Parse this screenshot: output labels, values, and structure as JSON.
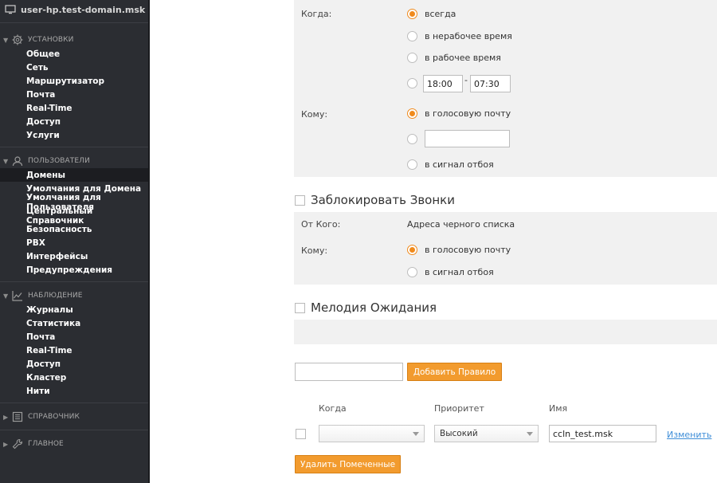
{
  "sidebar": {
    "host": "user-hp.test-domain.msk",
    "sections": [
      {
        "title": "Установки",
        "icon": "gear-icon",
        "items": [
          "Общее",
          "Сеть",
          "Маршрутизатор",
          "Почта",
          "Real-Time",
          "Доступ",
          "Услуги"
        ]
      },
      {
        "title": "Пользователи",
        "icon": "user-icon",
        "items": [
          "Домены",
          "Умолчания для Домена",
          "Умолчания для Пользователя",
          "Центральный Справочник",
          "Безопасность",
          "PBX",
          "Интерфейсы",
          "Предупреждения"
        ]
      },
      {
        "title": "Наблюдение",
        "icon": "chart-icon",
        "items": [
          "Журналы",
          "Статистика",
          "Почта",
          "Real-Time",
          "Доступ",
          "Кластер",
          "Нити"
        ]
      },
      {
        "title": "Справочник",
        "icon": "directory-icon",
        "items": []
      },
      {
        "title": "Главное",
        "icon": "wrench-icon",
        "items": []
      }
    ],
    "active_item": "Домены"
  },
  "forward": {
    "when_label": "Когда:",
    "when_options": [
      "всегда",
      "в нерабочее время",
      "в рабочее время"
    ],
    "time_from": "18:00",
    "time_sep": "-",
    "time_to": "07:30",
    "to_label": "Кому:",
    "to_options": [
      "в голосовую почту",
      "в сигнал отбоя"
    ],
    "to_custom_value": ""
  },
  "block": {
    "title": "Заблокировать Звонки",
    "from_label": "От Кого:",
    "from_value": "Адреса черного списка",
    "to_label": "Кому:",
    "to_options": [
      "в голосовую почту",
      "в сигнал отбоя"
    ]
  },
  "hold": {
    "title": "Мелодия Ожидания"
  },
  "rules": {
    "new_rule_value": "",
    "add_button": "Добавить Правило",
    "columns": [
      "Когда",
      "Приоритет",
      "Имя"
    ],
    "row": {
      "when": "",
      "priority": "Высокий",
      "name": "ccln_test.msk",
      "edit": "Изменить"
    },
    "delete_button": "Удалить Помеченные"
  },
  "colors": {
    "accent": "#f29b2e",
    "sidebar": "#2b2d32",
    "link": "#3f8ed8"
  }
}
